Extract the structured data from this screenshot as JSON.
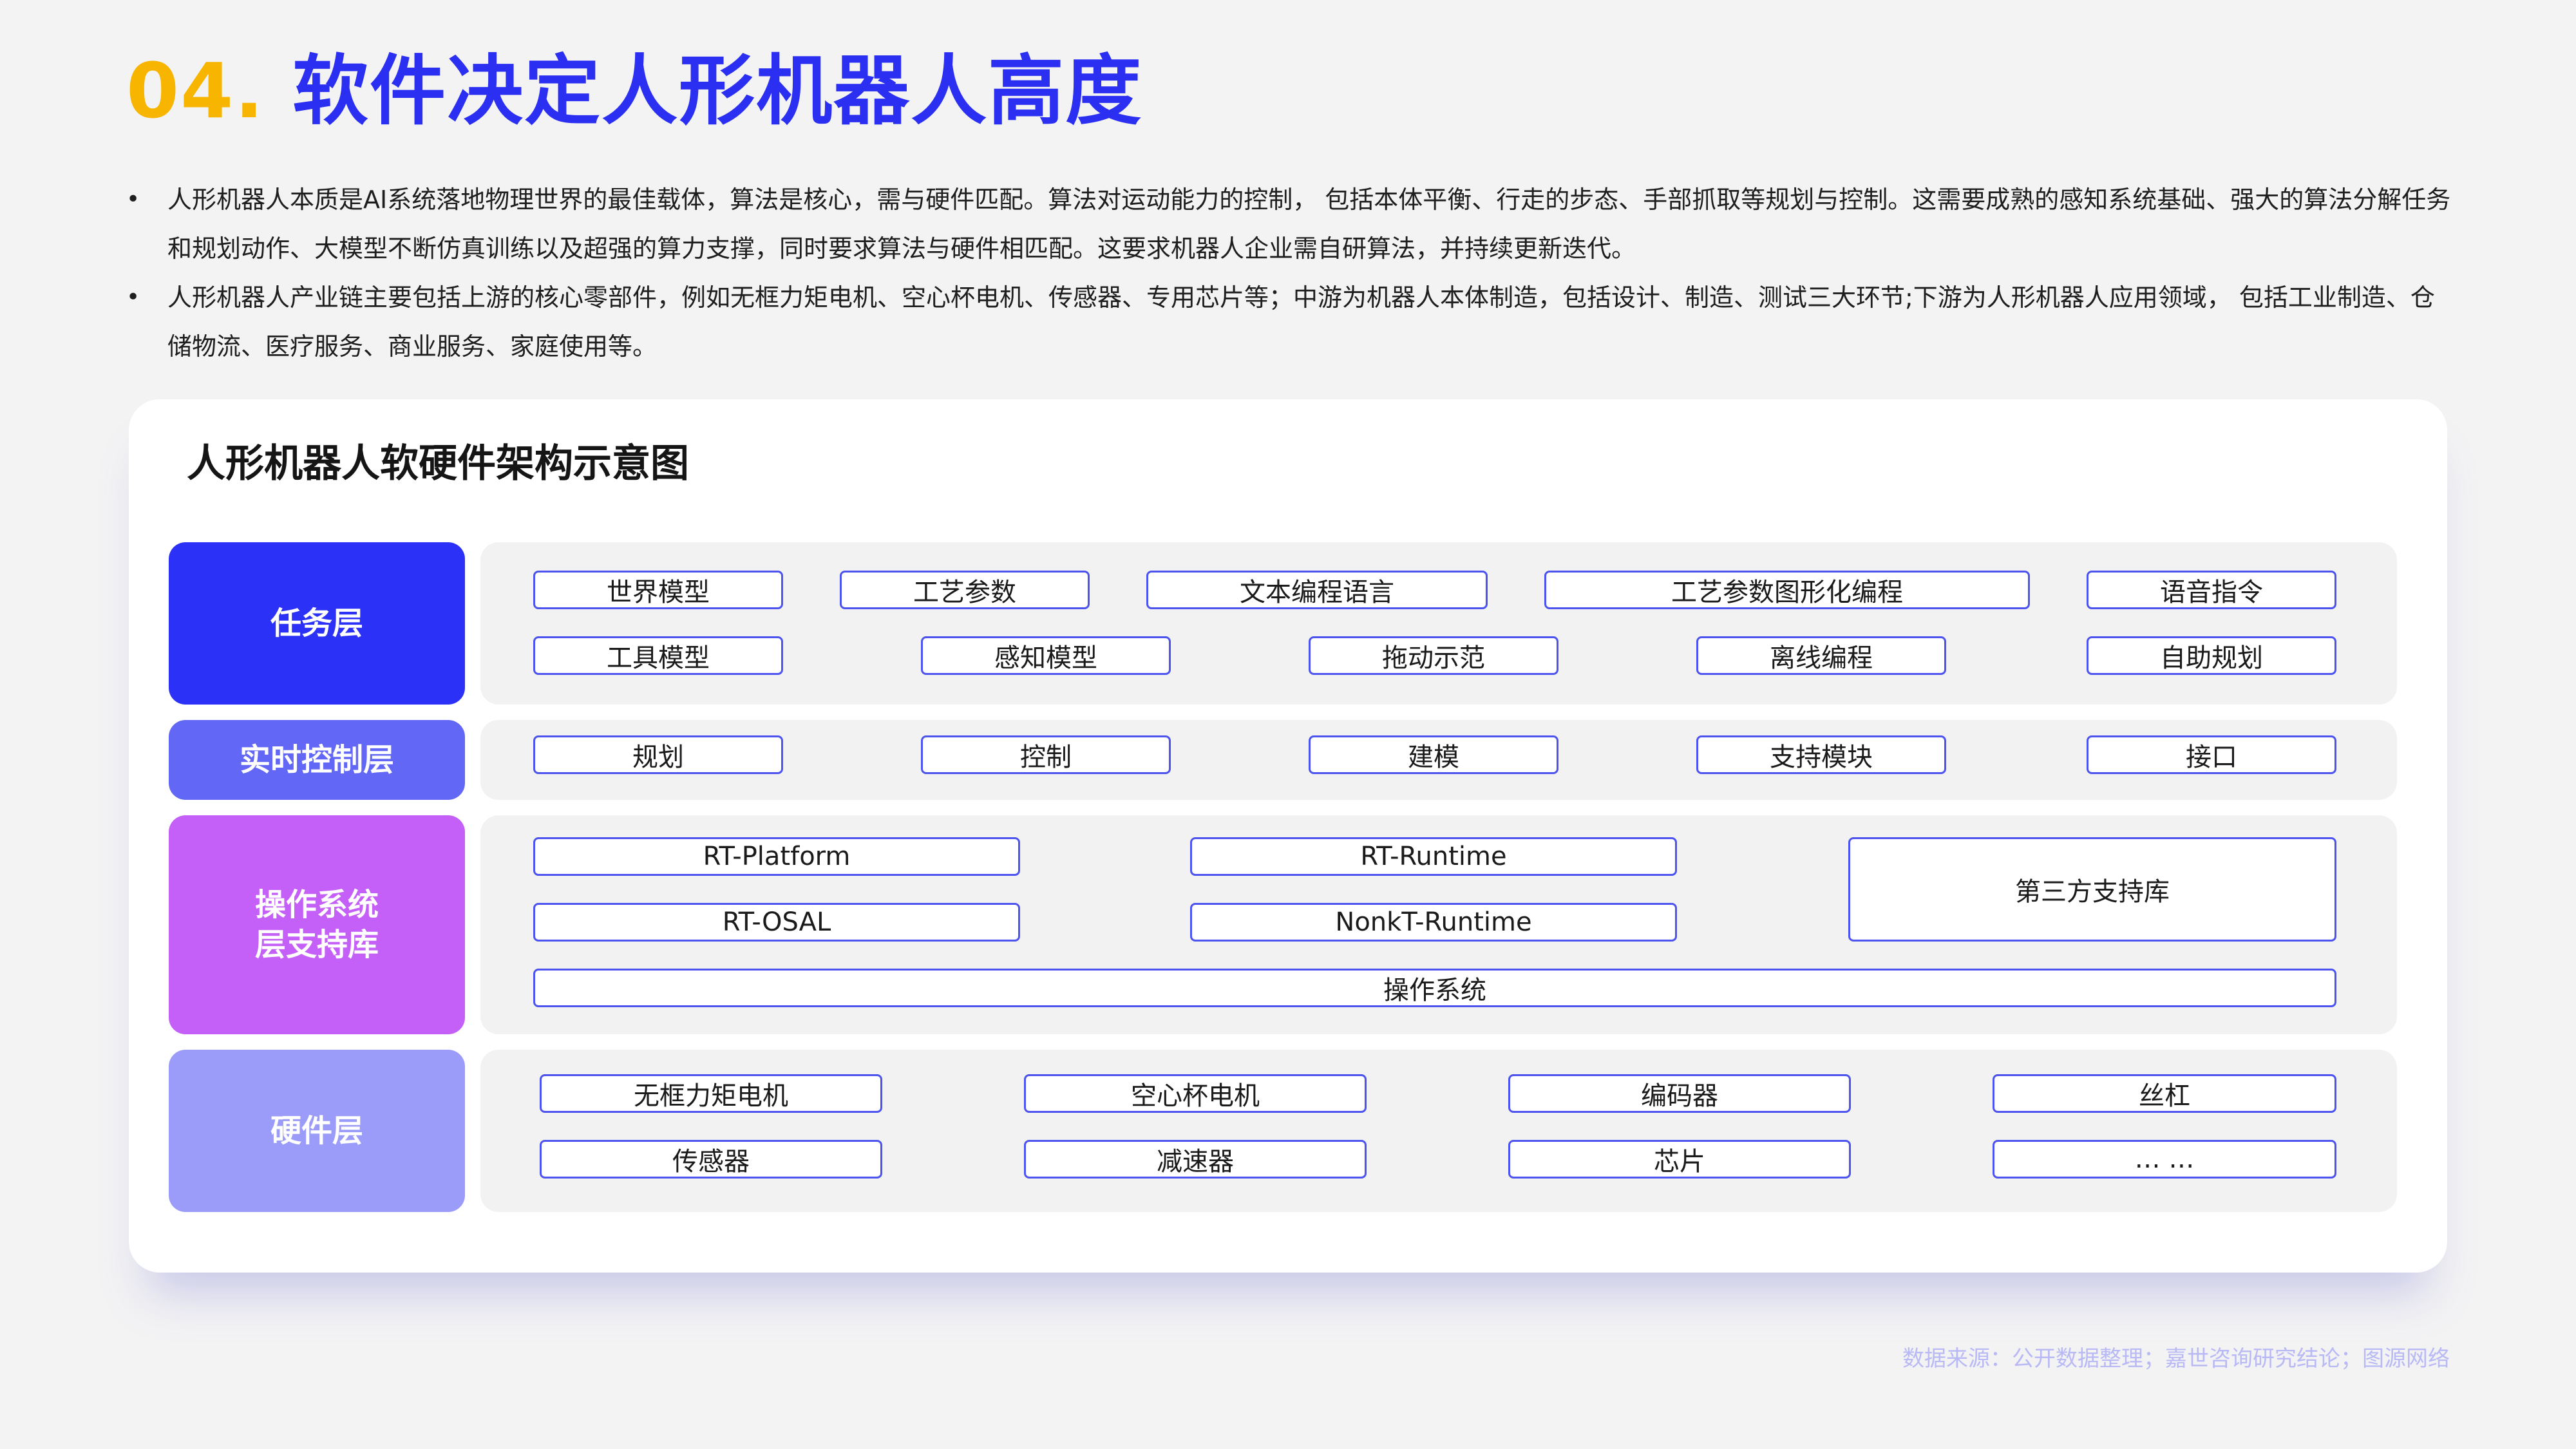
{
  "header": {
    "number": "04.",
    "title": "软件决定人形机器人高度"
  },
  "bullets": [
    "人形机器人本质是AI系统落地物理世界的最佳载体，算法是核心，需与硬件匹配。算法对运动能力的控制， 包括本体平衡、行走的步态、手部抓取等规划与控制。这需要成熟的感知系统基础、强大的算法分解任务和规划动作、大模型不断仿真训练以及超强的算力支撑，同时要求算法与硬件相匹配。这要求机器人企业需自研算法，并持续更新迭代。",
    "人形机器人产业链主要包括上游的核心零部件，例如无框力矩电机、空心杯电机、传感器、专用芯片等；中游为机器人本体制造，包括设计、制造、测试三大环节;下游为人形机器人应用领域， 包括工业制造、仓储物流、医疗服务、商业服务、家庭使用等。"
  ],
  "diagram": {
    "title": "人形机器人软硬件架构示意图",
    "layers": {
      "task": {
        "label": "任务层",
        "row1": [
          "世界模型",
          "工艺参数",
          "文本编程语言",
          "工艺参数图形化编程",
          "语音指令"
        ],
        "row2": [
          "工具模型",
          "感知模型",
          "拖动示范",
          "离线编程",
          "自助规划"
        ]
      },
      "realtime": {
        "label": "实时控制层",
        "items": [
          "规划",
          "控制",
          "建模",
          "支持模块",
          "接口"
        ]
      },
      "os": {
        "label_line1": "操作系统",
        "label_line2": "层支持库",
        "items": [
          "RT-Platform",
          "RT-Runtime",
          "第三方支持库",
          "RT-OSAL",
          "NonkT-Runtime",
          "操作系统"
        ]
      },
      "hardware": {
        "label": "硬件层",
        "row1": [
          "无框力矩电机",
          "空心杯电机",
          "编码器",
          "丝杠"
        ],
        "row2": [
          "传感器",
          "减速器",
          "芯片",
          "… …"
        ]
      }
    }
  },
  "source": "数据来源：公开数据整理；嘉世咨询研究结论；图源网络",
  "colors": {
    "title_number": "#f7b500",
    "title_text": "#2b2ff2",
    "task_layer": "#2b31f6",
    "realtime_layer": "#6268f5",
    "os_layer": "#c45ff8",
    "hardware_layer": "#9b9cf9",
    "box_border": "#4c53ee",
    "source_text": "#b8b9f5"
  }
}
